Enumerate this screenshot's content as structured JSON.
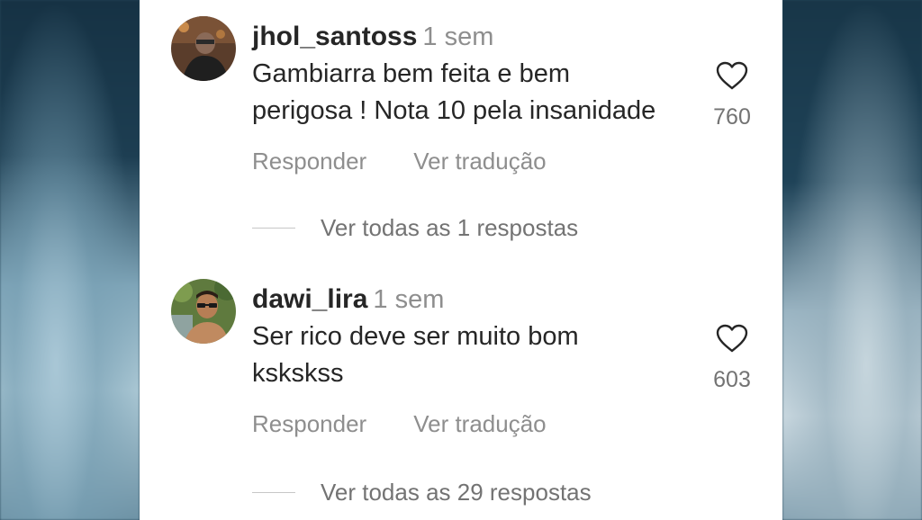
{
  "comments": [
    {
      "username": "jhol_santoss",
      "time": "1 sem",
      "text_line1": "Gambiarra bem feita e bem",
      "text_line2": "perigosa ! Nota 10 pela insanidade",
      "likes": "760",
      "reply_label": "Responder",
      "translate_label": "Ver tradução",
      "view_replies": "Ver todas as 1 respostas"
    },
    {
      "username": "dawi_lira",
      "time": "1 sem",
      "text_line1": "Ser rico deve ser muito bom",
      "text_line2": "kskskss",
      "likes": "603",
      "reply_label": "Responder",
      "translate_label": "Ver tradução",
      "view_replies": "Ver todas as 29 respostas"
    }
  ],
  "icons": {
    "like": "heart-outline-icon"
  },
  "colors": {
    "username": "#262626",
    "secondary": "#8e8e8e",
    "background": "#ffffff"
  }
}
